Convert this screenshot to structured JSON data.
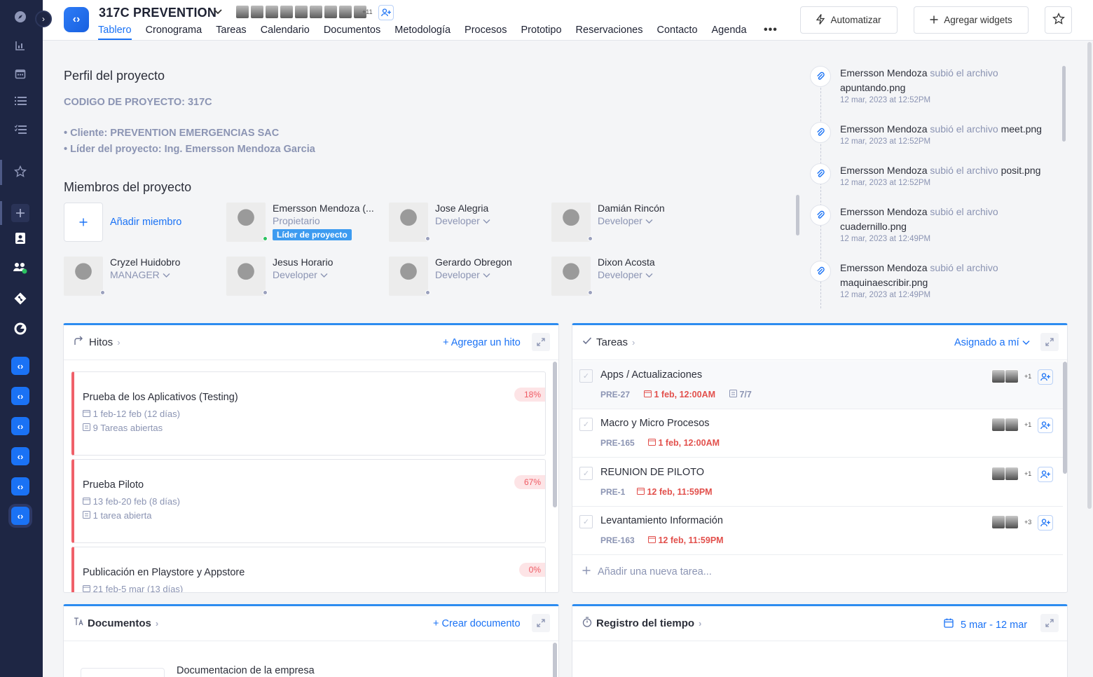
{
  "sidebar": {
    "toggle": "›",
    "icons": [
      "compass-icon",
      "chart-icon",
      "calendar-icon",
      "list-icon",
      "checklist-icon",
      "star-icon",
      "plus-icon",
      "contacts-icon",
      "team-icon",
      "git-icon",
      "pie-icon"
    ],
    "app_logo": "‹›"
  },
  "header": {
    "project_title": "317C PREVENTION",
    "avatars_more": "+11",
    "nav": [
      "Tablero",
      "Cronograma",
      "Tareas",
      "Calendario",
      "Documentos",
      "Metodología",
      "Procesos",
      "Prototipo",
      "Reservaciones",
      "Contacto",
      "Agenda"
    ],
    "nav_more": "•••",
    "automatizar": "Automatizar",
    "agregar_widgets": "Agregar widgets"
  },
  "profile": {
    "title": "Perfil del proyecto",
    "code": "CODIGO DE PROYECTO: 317C",
    "client": "• Cliente: PREVENTION EMERGENCIAS SAC",
    "leader": "• Líder del proyecto: Ing. Emersson Mendoza Garcia"
  },
  "members": {
    "title": "Miembros del proyecto",
    "add_label": "Añadir miembro",
    "list": [
      {
        "name": "Emersson Mendoza (...",
        "role": "Propietario",
        "badge": "Líder de proyecto"
      },
      {
        "name": "Jose Alegria",
        "role": "Developer"
      },
      {
        "name": "Damián Rincón",
        "role": "Developer"
      },
      {
        "name": "Cryzel Huidobro",
        "role": "MANAGER"
      },
      {
        "name": "Jesus Horario",
        "role": "Developer"
      },
      {
        "name": "Gerardo Obregon",
        "role": "Developer"
      },
      {
        "name": "Dixon Acosta",
        "role": "Developer"
      }
    ]
  },
  "activity": [
    {
      "user": "Emersson Mendoza",
      "action": "subió el archivo",
      "file": "apuntando.png",
      "date": "12 mar, 2023 at 12:52PM"
    },
    {
      "user": "Emersson Mendoza",
      "action": "subió el archivo",
      "file": "meet.png",
      "date": "12 mar, 2023 at 12:52PM"
    },
    {
      "user": "Emersson Mendoza",
      "action": "subió el archivo",
      "file": "posit.png",
      "date": "12 mar, 2023 at 12:52PM"
    },
    {
      "user": "Emersson Mendoza",
      "action": "subió el archivo",
      "file": "cuadernillo.png",
      "date": "12 mar, 2023 at 12:49PM"
    },
    {
      "user": "Emersson Mendoza",
      "action": "subió el archivo",
      "file": "maquinaescribir.png",
      "date": "12 mar, 2023 at 12:49PM"
    }
  ],
  "hitos": {
    "title": "Hitos",
    "action": "+ Agregar un hito",
    "items": [
      {
        "title": "Prueba de los Aplicativos (Testing)",
        "dates": "1 feb-12 feb (12 días)",
        "tasks": "9 Tareas abiertas",
        "pct": "18%"
      },
      {
        "title": "Prueba Piloto",
        "dates": "13 feb-20 feb (8 días)",
        "tasks": "1 tarea abierta",
        "pct": "67%"
      },
      {
        "title": "Publicación en Playstore y Appstore",
        "dates": "21 feb-5 mar (13 días)",
        "tasks": "",
        "pct": "0%"
      }
    ]
  },
  "tareas": {
    "title": "Tareas",
    "filter": "Asignado a mí",
    "items": [
      {
        "title": "Apps / Actualizaciones",
        "code": "PRE-27",
        "date": "1 feb, 12:00AM",
        "sub": "7/7",
        "more": "+1"
      },
      {
        "title": "Macro y Micro Procesos",
        "code": "PRE-165",
        "date": "1 feb, 12:00AM",
        "sub": "",
        "more": "+1"
      },
      {
        "title": "REUNION DE PILOTO",
        "code": "PRE-1",
        "date": "12 feb, 11:59PM",
        "sub": "",
        "more": "+1"
      },
      {
        "title": "Levantamiento Información",
        "code": "PRE-163",
        "date": "12 feb, 11:59PM",
        "sub": "",
        "more": "+3"
      }
    ],
    "add": "Añadir una nueva tarea..."
  },
  "documentos": {
    "title": "Documentos",
    "action": "+ Crear documento",
    "first_doc": "Documentacion de la empresa"
  },
  "registro": {
    "title": "Registro del tiempo",
    "range": "5 mar - 12 mar"
  },
  "colors": {
    "accent": "#1a72f5",
    "sidebar": "#1e2644",
    "danger": "#ef5a63",
    "muted": "#8b94b3"
  }
}
